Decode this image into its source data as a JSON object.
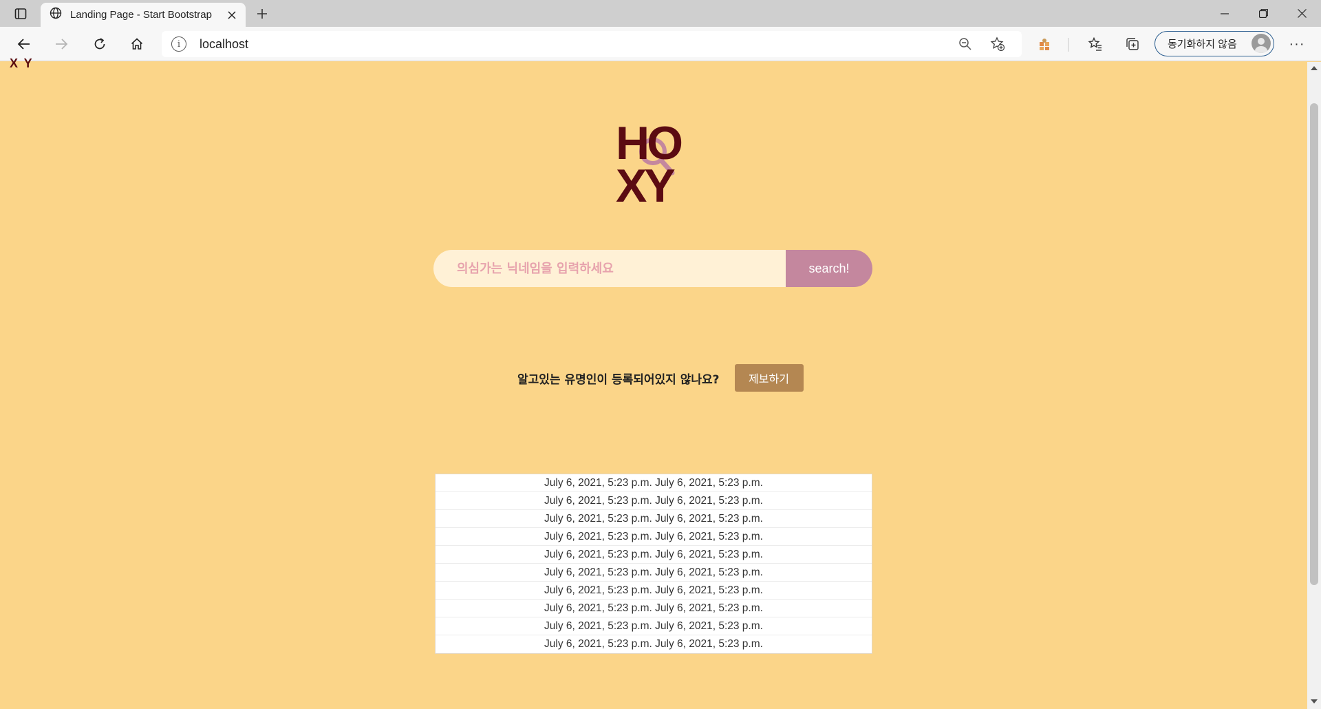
{
  "browser": {
    "tab_title": "Landing Page - Start Bootstrap T",
    "url": "localhost",
    "profile_label": "동기화하지 않음",
    "icons": {
      "tab_actions": "tab-actions-icon",
      "tab_favicon": "globe-icon",
      "close_tab": "close-icon",
      "new_tab": "plus-icon",
      "back": "back-arrow-icon",
      "forward": "forward-arrow-icon",
      "refresh": "refresh-icon",
      "home": "home-icon",
      "info": "info-icon",
      "zoom": "zoom-out-icon",
      "add_favorite": "star-plus-icon",
      "extension": "extension-icon",
      "favorites": "favorites-icon",
      "collections": "collections-icon",
      "more": "more-icon",
      "minimize": "minimize-icon",
      "restore": "restore-icon",
      "close_window": "close-icon"
    }
  },
  "page": {
    "corner_mark": "X Y",
    "logo": {
      "line1": "HO",
      "line2": "XY",
      "text_color": "#5b0b12",
      "lens_color": "#c4879e"
    },
    "search": {
      "placeholder": "의심가는 닉네임을 입력하세요",
      "button_label": "search!"
    },
    "report": {
      "text": "알고있는 유명인이 등록되어있지 않나요?",
      "button_label": "제보하기"
    },
    "list_items": [
      "July 6, 2021, 5:23 p.m. July 6, 2021, 5:23 p.m.",
      "July 6, 2021, 5:23 p.m. July 6, 2021, 5:23 p.m.",
      "July 6, 2021, 5:23 p.m. July 6, 2021, 5:23 p.m.",
      "July 6, 2021, 5:23 p.m. July 6, 2021, 5:23 p.m.",
      "July 6, 2021, 5:23 p.m. July 6, 2021, 5:23 p.m.",
      "July 6, 2021, 5:23 p.m. July 6, 2021, 5:23 p.m.",
      "July 6, 2021, 5:23 p.m. July 6, 2021, 5:23 p.m.",
      "July 6, 2021, 5:23 p.m. July 6, 2021, 5:23 p.m.",
      "July 6, 2021, 5:23 p.m. July 6, 2021, 5:23 p.m.",
      "July 6, 2021, 5:23 p.m. July 6, 2021, 5:23 p.m."
    ],
    "colors": {
      "background": "#fbd589",
      "search_field": "#fff1d6",
      "search_button": "#c4879e",
      "report_button": "#b48752"
    }
  }
}
